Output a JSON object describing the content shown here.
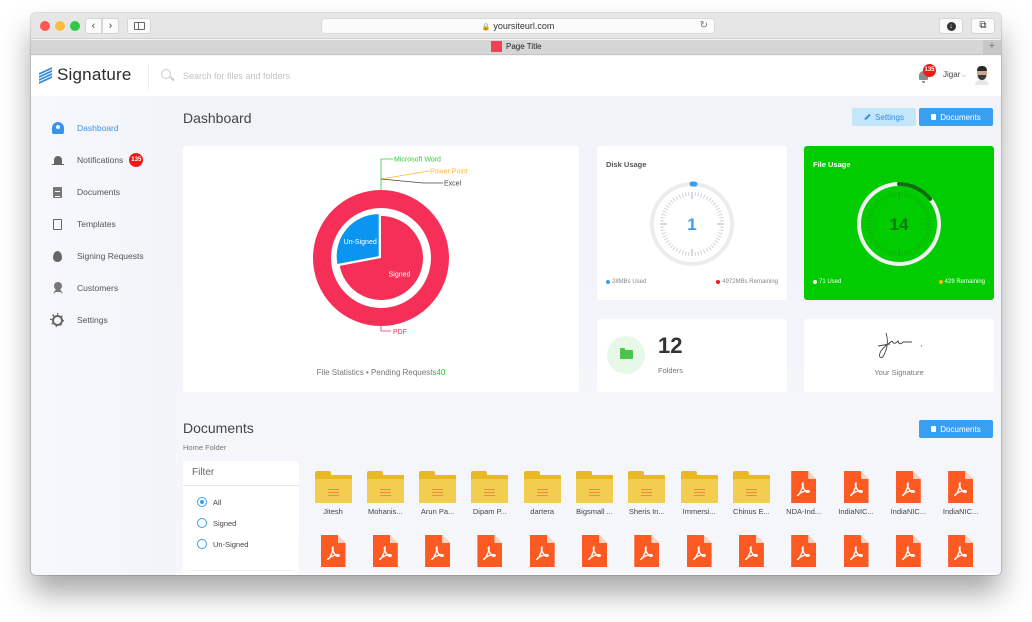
{
  "browser": {
    "url": "yoursiteurl.com",
    "tab_title": "Page Title",
    "tab_color": "#f43f54"
  },
  "header": {
    "logo_text": "Signature",
    "search_placeholder": "Search for files and folders",
    "search_value": "",
    "notification_count": "135",
    "user_name": "Jigar"
  },
  "sidebar": {
    "items": [
      {
        "label": "Dashboard",
        "icon": "dashboard-icon",
        "active": true
      },
      {
        "label": "Notifications",
        "icon": "bell-icon",
        "badge": "135"
      },
      {
        "label": "Documents",
        "icon": "document-icon"
      },
      {
        "label": "Templates",
        "icon": "template-icon"
      },
      {
        "label": "Signing Requests",
        "icon": "drop-icon"
      },
      {
        "label": "Customers",
        "icon": "customer-icon"
      },
      {
        "label": "Settings",
        "icon": "gear-icon"
      }
    ]
  },
  "dashboard": {
    "title": "Dashboard",
    "settings_label": "Settings",
    "documents_label": "Documents"
  },
  "chart_data": {
    "type": "pie",
    "title": "File Statistics",
    "outer_ring": {
      "slices": [
        {
          "label": "PDF",
          "value": 100,
          "color": "#f52f57"
        },
        {
          "label": "Microsoft Word",
          "value": 0,
          "color": "#33cc33"
        },
        {
          "label": "Power Point",
          "value": 0,
          "color": "#ffb833"
        },
        {
          "label": "Excel",
          "value": 0,
          "color": "#444444"
        }
      ]
    },
    "inner_pie": {
      "slices": [
        {
          "label": "Signed",
          "value": 72,
          "color": "#f52f57"
        },
        {
          "label": "Un-Signed",
          "value": 28,
          "color": "#0a96f0"
        }
      ]
    },
    "footer_text": "File Statistics • Pending Requests",
    "pending_requests": "40"
  },
  "disk_usage": {
    "title": "Disk Usage",
    "value": "1",
    "used_label": "28MBs Used",
    "remaining_label": "4972MBs Remaining",
    "used_fraction": 0.0056,
    "used_color": "#3a9ff0",
    "remaining_color": "#f01818"
  },
  "file_usage": {
    "title": "File Usage",
    "value": "14",
    "used_label": "71 Used",
    "remaining_label": "429 Remaining",
    "used_fraction": 0.142,
    "used_color": "#ffffff",
    "remaining_color": "#ffb800"
  },
  "folders": {
    "count": "12",
    "label": "Folders"
  },
  "signature": {
    "label": "Your Signature"
  },
  "documents": {
    "title": "Documents",
    "breadcrumb": "Home Folder",
    "button_label": "Documents",
    "filter": {
      "title": "Filter",
      "options": [
        {
          "label": "All",
          "checked": true
        },
        {
          "label": "Signed",
          "checked": false
        },
        {
          "label": "Un-Signed",
          "checked": false
        }
      ]
    },
    "row1": [
      {
        "type": "folder",
        "name": "Jitesh"
      },
      {
        "type": "folder",
        "name": "Mohanis..."
      },
      {
        "type": "folder",
        "name": "Arun Pa..."
      },
      {
        "type": "folder",
        "name": "Dipam P..."
      },
      {
        "type": "folder",
        "name": "dartera"
      },
      {
        "type": "folder",
        "name": "Bigsmall ..."
      },
      {
        "type": "folder",
        "name": "Sheris In..."
      },
      {
        "type": "folder",
        "name": "Immersi..."
      },
      {
        "type": "folder",
        "name": "Chinus E..."
      },
      {
        "type": "pdf",
        "name": "NDA-Ind..."
      },
      {
        "type": "pdf",
        "name": "IndiaNIC..."
      },
      {
        "type": "pdf",
        "name": "IndiaNIC..."
      },
      {
        "type": "pdf",
        "name": "IndiaNIC..."
      }
    ],
    "row2_pdf_count": 13
  }
}
